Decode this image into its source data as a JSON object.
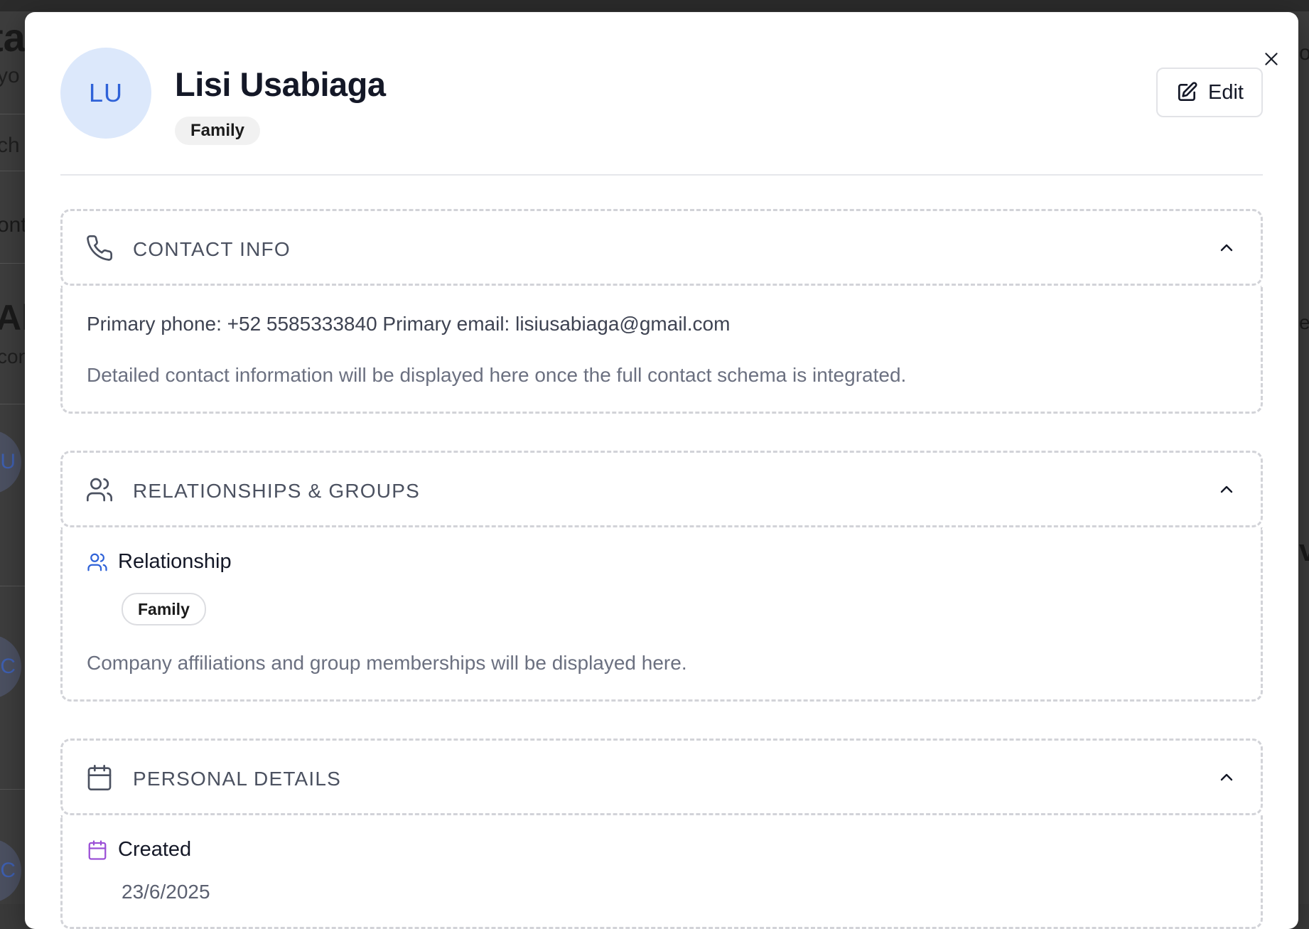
{
  "background": {
    "fragments": [
      "ta",
      "yo",
      "ch",
      "ont",
      "All",
      "con",
      "LU",
      "TC",
      "TC",
      "o",
      "ex",
      "v"
    ]
  },
  "contact": {
    "initials": "LU",
    "name": "Lisi Usabiaga",
    "tag": "Family"
  },
  "toolbar": {
    "edit_label": "Edit"
  },
  "sections": {
    "contact_info": {
      "title": "CONTACT INFO",
      "primary_line": "Primary phone: +52 5585333840 Primary email: lisiusabiaga@gmail.com",
      "note": "Detailed contact information will be displayed here once the full contact schema is integrated."
    },
    "relationships": {
      "title": "RELATIONSHIPS & GROUPS",
      "sub_label": "Relationship",
      "relationship_value": "Family",
      "note": "Company affiliations and group memberships will be displayed here."
    },
    "personal": {
      "title": "PERSONAL DETAILS",
      "created_label": "Created",
      "created_value": "23/6/2025"
    }
  },
  "colors": {
    "accent_blue": "#2f62d8",
    "avatar_bg": "#dce8fb",
    "calendar_purple": "#9b4fd6"
  }
}
